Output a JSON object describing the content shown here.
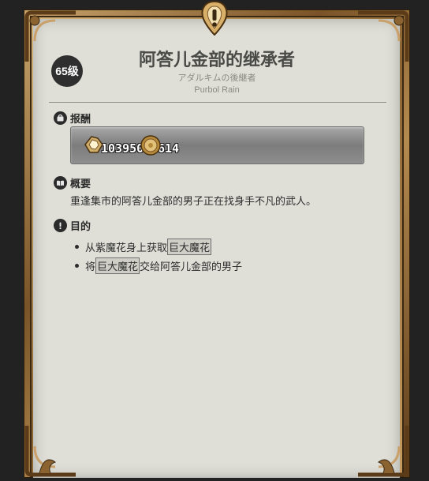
{
  "quest": {
    "level": "65级",
    "title": "阿答儿金部的继承者",
    "subtitle_ja": "アダルキムの後継者",
    "subtitle_en": "Purbol Rain"
  },
  "reward": {
    "header": "报酬",
    "exp_icon": "experience-icon",
    "exp_value": "103950",
    "gil_icon": "gil-coin-icon",
    "gil_value": "614"
  },
  "summary": {
    "header": "概要",
    "text": "重逢集市的阿答儿金部的男子正在找身手不凡的武人。"
  },
  "objectives": {
    "header": "目的",
    "items": [
      {
        "pre": "从紫魔花身上获取",
        "hl": "巨大魔花",
        "post": ""
      },
      {
        "pre": "将",
        "hl": "巨大魔花",
        "post": "交给阿答儿金部的男子"
      }
    ]
  },
  "colors": {
    "panel": "#dfdfd8",
    "frame_gold": "#b48a4f",
    "text": "#2c2c2c"
  }
}
